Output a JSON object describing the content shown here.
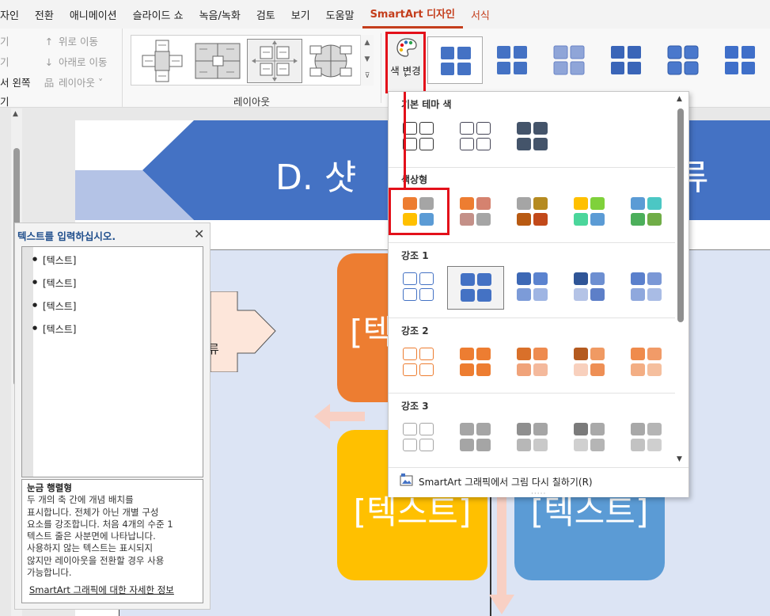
{
  "menubar": {
    "items": [
      "자인",
      "전환",
      "애니메이션",
      "슬라이드 쇼",
      "녹음/녹화",
      "검토",
      "보기",
      "도움말"
    ],
    "active_tab": "SmartArt 디자인",
    "context_tab": "서식"
  },
  "ribbon": {
    "left_group": {
      "row1_left": "기",
      "row1_right": "위로 이동",
      "row2_left": "기",
      "row2_right": "아래로 이동",
      "row3_left": "서 왼쪽",
      "row3_right": "레이아웃",
      "row4_left": "기"
    },
    "layouts_label": "레이아웃",
    "change_colors_label": "색 변경"
  },
  "slide": {
    "title_left": "D. 샷",
    "title_right": "류",
    "arrow_text": "류",
    "box1_text": "[텍",
    "box2_text": "[텍스트]",
    "box3_text": "[텍스트]"
  },
  "textpane": {
    "title": "텍스트를 입력하십시오.",
    "items": [
      "[텍스트]",
      "[텍스트]",
      "[텍스트]",
      "[텍스트]"
    ],
    "desc_title": "눈금 행렬형",
    "desc_lines": [
      "두 개의 축 간에 개념 배치를",
      "표시합니다. 전체가 아닌 개별 구성",
      "요소를 강조합니다. 처음 4개의 수준 1",
      "텍스트 줄은 사분면에 나타납니다.",
      "사용하지 않는 텍스트는 표시되지",
      "않지만 레이아웃을 전환할 경우 사용",
      "가능합니다."
    ],
    "desc_link": "SmartArt 그래픽에 대한 자세한 정보"
  },
  "dropdown": {
    "sections": [
      {
        "title": "기본 테마 색"
      },
      {
        "title": "색상형"
      },
      {
        "title": "강조 1"
      },
      {
        "title": "강조 2"
      },
      {
        "title": "강조 3"
      }
    ],
    "footer": "SmartArt 그래픽에서 그림 다시 칠하기(R)"
  },
  "colors": {
    "accent_blue": "#4472c4",
    "orange": "#ed7d31",
    "gold": "#ffc000",
    "light_blue": "#5b9bd5",
    "highlight_red": "#e3101a"
  }
}
